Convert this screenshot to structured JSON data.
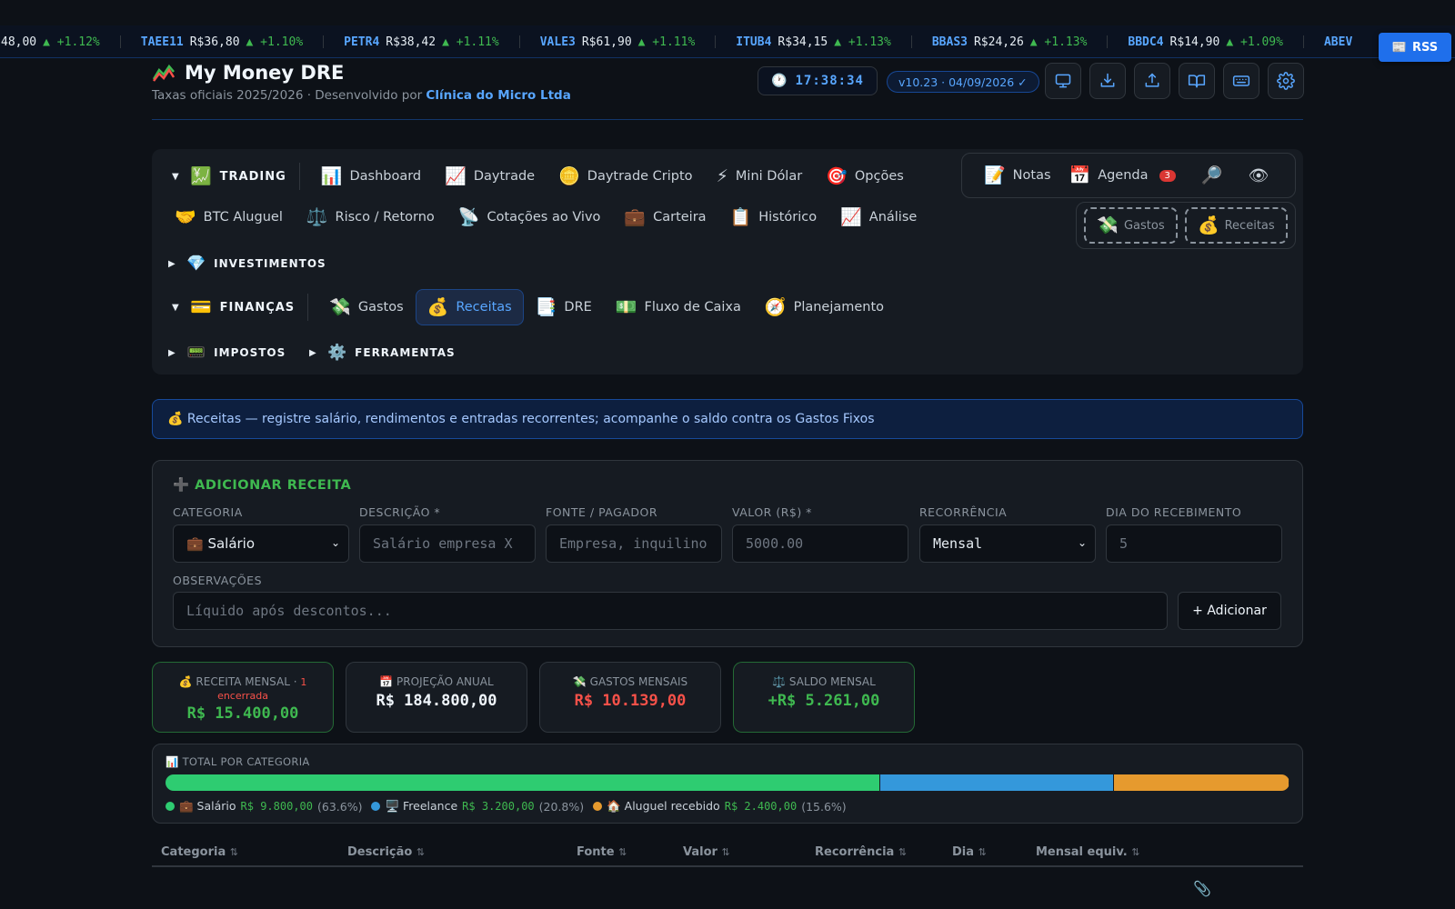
{
  "ticker": [
    {
      "sym": "",
      "price": "48,00",
      "chg": "▲ +1.12%"
    },
    {
      "sym": "TAEE11",
      "price": "R$36,80",
      "chg": "▲ +1.10%"
    },
    {
      "sym": "PETR4",
      "price": "R$38,42",
      "chg": "▲ +1.11%"
    },
    {
      "sym": "VALE3",
      "price": "R$61,90",
      "chg": "▲ +1.11%"
    },
    {
      "sym": "ITUB4",
      "price": "R$34,15",
      "chg": "▲ +1.13%"
    },
    {
      "sym": "BBAS3",
      "price": "R$24,26",
      "chg": "▲ +1.13%"
    },
    {
      "sym": "BBDC4",
      "price": "R$14,90",
      "chg": "▲ +1.09%"
    },
    {
      "sym": "ABEV",
      "price": "",
      "chg": ""
    }
  ],
  "rss_label": "RSS",
  "header": {
    "title": "My Money DRE",
    "subtitle_prefix": "Taxas oficiais 2025/2026 · Desenvolvido por ",
    "subtitle_company": "Clínica do Micro Ltda",
    "clock": "17:38:34",
    "version": "v10.23 · 04/09/2026 ✓"
  },
  "header_buttons": [
    "monitor-icon",
    "download-icon",
    "upload-icon",
    "book-icon",
    "keyboard-icon",
    "gear-icon"
  ],
  "nav": {
    "trading": {
      "label": "TRADING",
      "items": [
        "Dashboard",
        "Daytrade",
        "Daytrade Cripto",
        "Mini Dólar",
        "Opções",
        "BTC Aluguel",
        "Risco / Retorno",
        "Cotações ao Vivo",
        "Carteira",
        "Histórico",
        "Análise"
      ]
    },
    "investimentos": {
      "label": "INVESTIMENTOS"
    },
    "financas": {
      "label": "FINANÇAS",
      "items": [
        "Gastos",
        "Receitas",
        "DRE",
        "Fluxo de Caixa",
        "Planejamento"
      ],
      "active": "Receitas"
    },
    "impostos": {
      "label": "IMPOSTOS"
    },
    "ferramentas": {
      "label": "FERRAMENTAS"
    }
  },
  "quick": {
    "notas": "Notas",
    "agenda": "Agenda",
    "agenda_badge": "3"
  },
  "favorites": [
    "Gastos",
    "Receitas"
  ],
  "banner": "💰 Receitas — registre salário, rendimentos e entradas recorrentes; acompanhe o saldo contra os Gastos Fixos",
  "form": {
    "title": "➕ ADICIONAR RECEITA",
    "labels": {
      "categoria": "CATEGORIA",
      "descricao": "DESCRIÇÃO *",
      "fonte": "FONTE / PAGADOR",
      "valor": "VALOR (R$) *",
      "recorrencia": "RECORRÊNCIA",
      "dia": "DIA DO RECEBIMENTO",
      "obs": "OBSERVAÇÕES"
    },
    "categoria_value": "💼 Salário",
    "recorrencia_value": "Mensal",
    "placeholders": {
      "descricao": "Salário empresa X",
      "fonte": "Empresa, inquilino...",
      "valor": "5000.00",
      "dia": "5",
      "obs": "Líquido após descontos..."
    },
    "add_label": "+ Adicionar"
  },
  "cards": {
    "receita": {
      "label": "💰 RECEITA MENSAL · ",
      "closed_count": "1",
      "closed_label": "encerrada",
      "value": "R$ 15.400,00",
      "color": "#3fb950"
    },
    "projecao": {
      "label": "📅 PROJEÇÃO ANUAL",
      "value": "R$ 184.800,00",
      "color": "#f0f6fc"
    },
    "gastos": {
      "label": "💸 GASTOS MENSAIS",
      "value": "R$ 10.139,00",
      "color": "#f85149"
    },
    "saldo": {
      "label": "⚖️ SALDO MENSAL",
      "value": "+R$ 5.261,00",
      "color": "#3fb950"
    }
  },
  "categories": {
    "title": "📊 TOTAL POR CATEGORIA",
    "items": [
      {
        "name": "💼 Salário",
        "value": "R$ 9.800,00",
        "pct": "(63.6%)",
        "share": 63.6,
        "color": "#2ecc71"
      },
      {
        "name": "🖥️ Freelance",
        "value": "R$ 3.200,00",
        "pct": "(20.8%)",
        "share": 20.8,
        "color": "#3498db"
      },
      {
        "name": "🏠 Aluguel recebido",
        "value": "R$ 2.400,00",
        "pct": "(15.6%)",
        "share": 15.6,
        "color": "#e69a2e"
      }
    ]
  },
  "table_headers": [
    "Categoria",
    "Descrição",
    "Fonte",
    "Valor",
    "Recorrência",
    "Dia",
    "Mensal equiv."
  ],
  "sort_glyph": "⇅"
}
